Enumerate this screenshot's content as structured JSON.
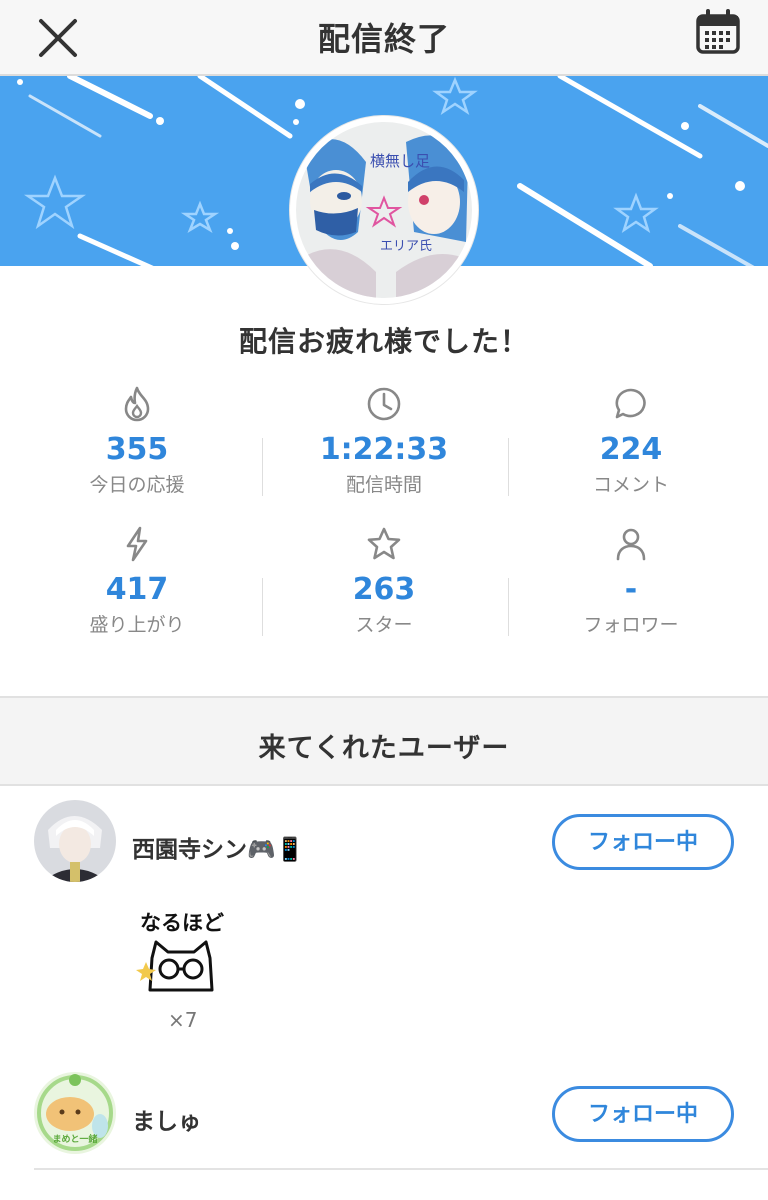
{
  "header": {
    "title": "配信終了",
    "close_icon": "close-icon",
    "calendar_icon": "calendar-icon"
  },
  "colors": {
    "accent": "#2f86db",
    "banner": "#4aa3ef",
    "header_bg": "#f7f7f7"
  },
  "avatar_text": {
    "left": "横無し足",
    "right": "エリア氏"
  },
  "thanks_message": "配信お疲れ様でした！",
  "stats": [
    {
      "icon": "flame-icon",
      "value": "355",
      "label": "今日の応援"
    },
    {
      "icon": "clock-icon",
      "value": "1:22:33",
      "label": "配信時間"
    },
    {
      "icon": "comment-icon",
      "value": "224",
      "label": "コメント"
    },
    {
      "icon": "lightning-icon",
      "value": "417",
      "label": "盛り上がり"
    },
    {
      "icon": "star-icon",
      "value": "263",
      "label": "スター"
    },
    {
      "icon": "person-icon",
      "value": "-",
      "label": "フォロワー"
    }
  ],
  "visitors_section": {
    "title": "来てくれたユーザー"
  },
  "users": [
    {
      "name": "西園寺シン🎮📱",
      "follow_label": "フォロー中",
      "stamp_text": "なるほど",
      "stamp_count": "×7"
    },
    {
      "name": "ましゅ",
      "follow_label": "フォロー中",
      "avatar_text": "まめと一緒"
    }
  ]
}
